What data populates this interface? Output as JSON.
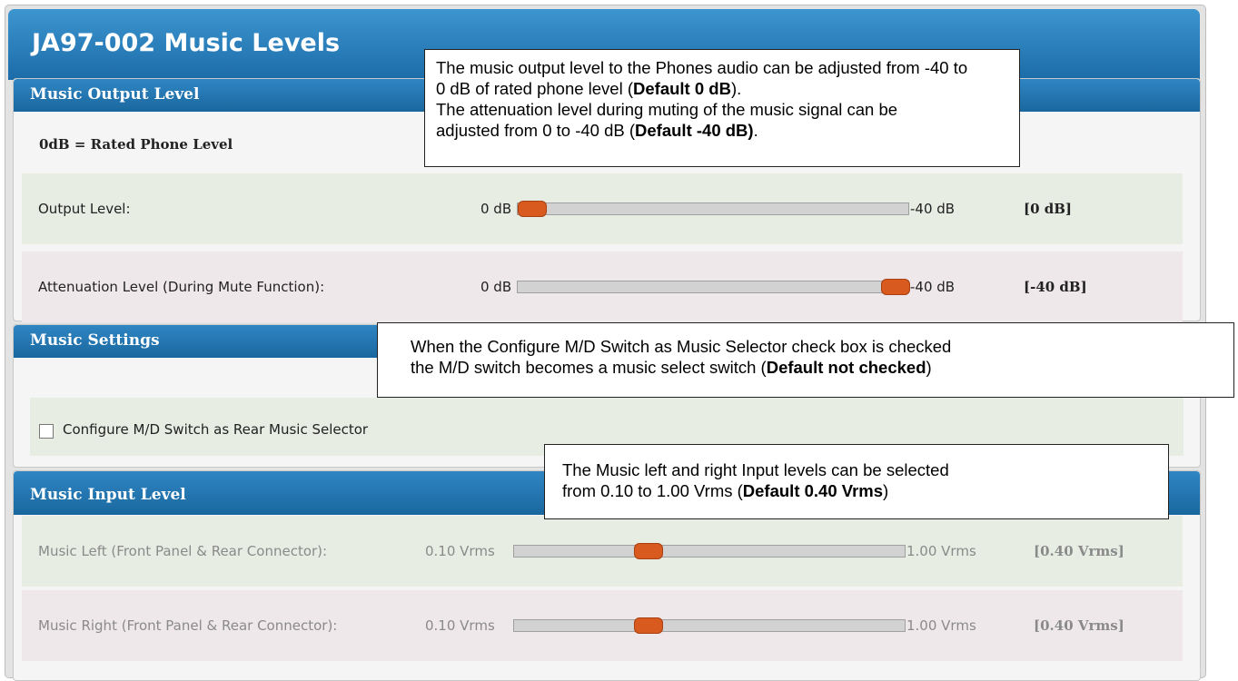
{
  "title": "JA97-002 Music Levels",
  "output_section": {
    "header": "Music Output Level",
    "subtitle": "0dB = Rated Phone Level",
    "rows": [
      {
        "label": "Output Level:",
        "min": "0 dB",
        "max": "-40 dB",
        "value": "[0 dB]",
        "fraction": 0.0
      },
      {
        "label": "Attenuation Level (During Mute Function):",
        "min": "0 dB",
        "max": "-40 dB",
        "value": "[-40 dB]",
        "fraction": 1.0
      }
    ]
  },
  "settings_section": {
    "header": "Music Settings",
    "checkbox_label": "Configure M/D Switch as Rear Music Selector",
    "checked": false
  },
  "input_section": {
    "header": "Music Input Level",
    "rows": [
      {
        "label": "Music Left (Front Panel & Rear Connector):",
        "min": "0.10 Vrms",
        "max": "1.00 Vrms",
        "value": "[0.40 Vrms]",
        "fraction": 0.33
      },
      {
        "label": "Music Right (Front Panel & Rear Connector):",
        "min": "0.10 Vrms",
        "max": "1.00 Vrms",
        "value": "[0.40 Vrms]",
        "fraction": 0.33
      }
    ]
  },
  "callouts": {
    "output": {
      "line1": "The music output level to the Phones audio can be adjusted from -40 to",
      "line2_a": "0 dB of rated phone level (",
      "line2_b": "Default 0 dB",
      "line2_c": ").",
      "line3": "The attenuation level during muting of the music signal can be",
      "line4_a": "adjusted from 0 to -40 dB (",
      "line4_b": "Default -40 dB)",
      "line4_c": "."
    },
    "settings": {
      "line1": "When the Configure M/D Switch as Music Selector check box is checked",
      "line2_a": "the M/D switch becomes a music select switch (",
      "line2_b": "Default not checked",
      "line2_c": ")"
    },
    "input": {
      "line1": "The Music left and right Input levels can be selected",
      "line2_a": "from 0.10 to 1.00 Vrms (",
      "line2_b": "Default 0.40 Vrms",
      "line2_c": ")"
    }
  },
  "colors": {
    "header_blue": "#1b6ca8",
    "knob_orange": "#d95a1e"
  }
}
